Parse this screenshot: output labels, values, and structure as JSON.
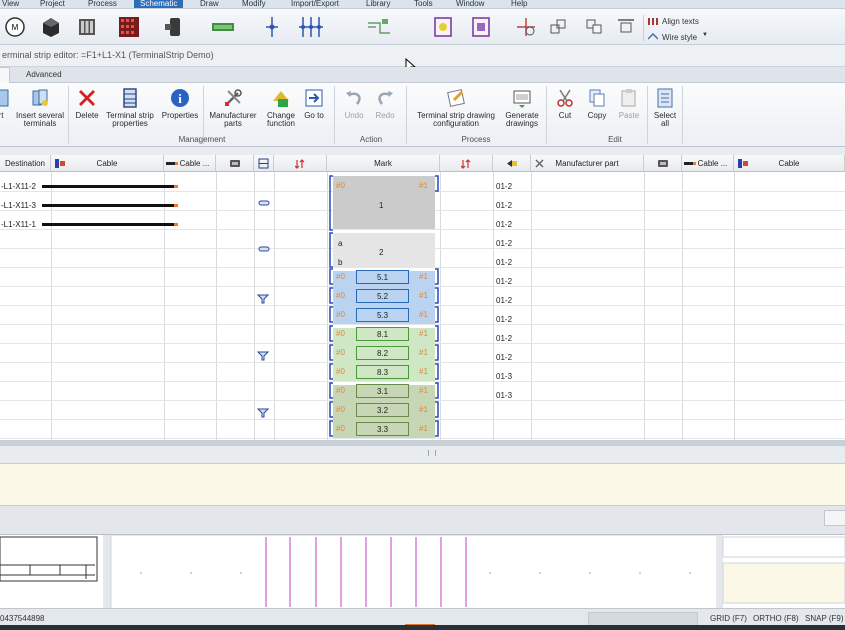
{
  "menu": [
    "View",
    "Project",
    "Process",
    "Schematic",
    "Draw",
    "Modify",
    "Import/Export",
    "Library",
    "Tools",
    "Window",
    "Help"
  ],
  "menu_active": "Schematic",
  "ribbon_top": {
    "align_texts": "Align texts",
    "wire_style": "Wire style"
  },
  "doc_title": "erminal strip editor: =F1+L1-X1 (TerminalStrip Demo)",
  "tabs": {
    "current": "",
    "advanced": "Advanced"
  },
  "ribbon": {
    "buttons": {
      "insert": "rt",
      "insert_several": "Insert several terminals",
      "delete": "Delete",
      "terminal_strip_props": "Terminal strip properties",
      "properties": "Properties",
      "manufacturer_parts": "Manufacturer parts",
      "change_function": "Change function",
      "go_to": "Go to",
      "undo": "Undo",
      "redo": "Redo",
      "ts_drawing_config": "Terminal strip drawing configuration",
      "generate_drawings": "Generate drawings",
      "cut": "Cut",
      "copy": "Copy",
      "paste": "Paste",
      "select_all": "Select all"
    },
    "groups": {
      "management": "Management",
      "action": "Action",
      "process": "Process",
      "edit": "Edit"
    }
  },
  "columns": {
    "destination": "Destination",
    "cable": "Cable",
    "cable_ellipsis": "Cable ...",
    "mark": "Mark",
    "manufacturer_part": "Manufacturer part",
    "cable_ellipsis2": "Cable ...",
    "cable2": "Cable"
  },
  "rows": [
    {
      "dest": "-L1-X11-2",
      "left": "#0",
      "mark": "",
      "right": "#1",
      "page": "01-2"
    },
    {
      "dest": "-L1-X11-3",
      "left": "",
      "mark": "1",
      "right": "",
      "page": "01-2"
    },
    {
      "dest": "-L1-X11-1",
      "left": "",
      "mark": "",
      "right": "",
      "page": "01-2"
    },
    {
      "dest": "",
      "left": "a",
      "mark": "2",
      "right": "",
      "page": "01-2"
    },
    {
      "dest": "",
      "left": "b",
      "mark": "",
      "right": "",
      "page": "01-2"
    },
    {
      "dest": "",
      "left": "#0",
      "mark": "5.1",
      "right": "#1",
      "page": "01-2"
    },
    {
      "dest": "",
      "left": "#0",
      "mark": "5.2",
      "right": "#1",
      "page": "01-2"
    },
    {
      "dest": "",
      "left": "#0",
      "mark": "5.3",
      "right": "#1",
      "page": "01-2"
    },
    {
      "dest": "",
      "left": "#0",
      "mark": "8.1",
      "right": "#1",
      "page": "01-2"
    },
    {
      "dest": "",
      "left": "#0",
      "mark": "8.2",
      "right": "#1",
      "page": "01-2"
    },
    {
      "dest": "",
      "left": "#0",
      "mark": "8.3",
      "right": "#1",
      "page": "01-3"
    },
    {
      "dest": "",
      "left": "#0",
      "mark": "3.1",
      "right": "#1",
      "page": "01-3"
    },
    {
      "dest": "",
      "left": "#0",
      "mark": "3.2",
      "right": "#1",
      "page": ""
    },
    {
      "dest": "",
      "left": "#0",
      "mark": "3.3",
      "right": "#1",
      "page": ""
    }
  ],
  "status": {
    "coord": "0437544898",
    "grid": "GRID (F7)",
    "ortho": "ORTHO (F8)",
    "snap": "SNAP (F9)"
  },
  "colors": {
    "accent": "#2e6db8",
    "mark_blue": "#b9d3f0",
    "mark_green": "#cfe7c4",
    "mark_gray": "#cfcfcf",
    "wire_end": "#f07a2a"
  }
}
